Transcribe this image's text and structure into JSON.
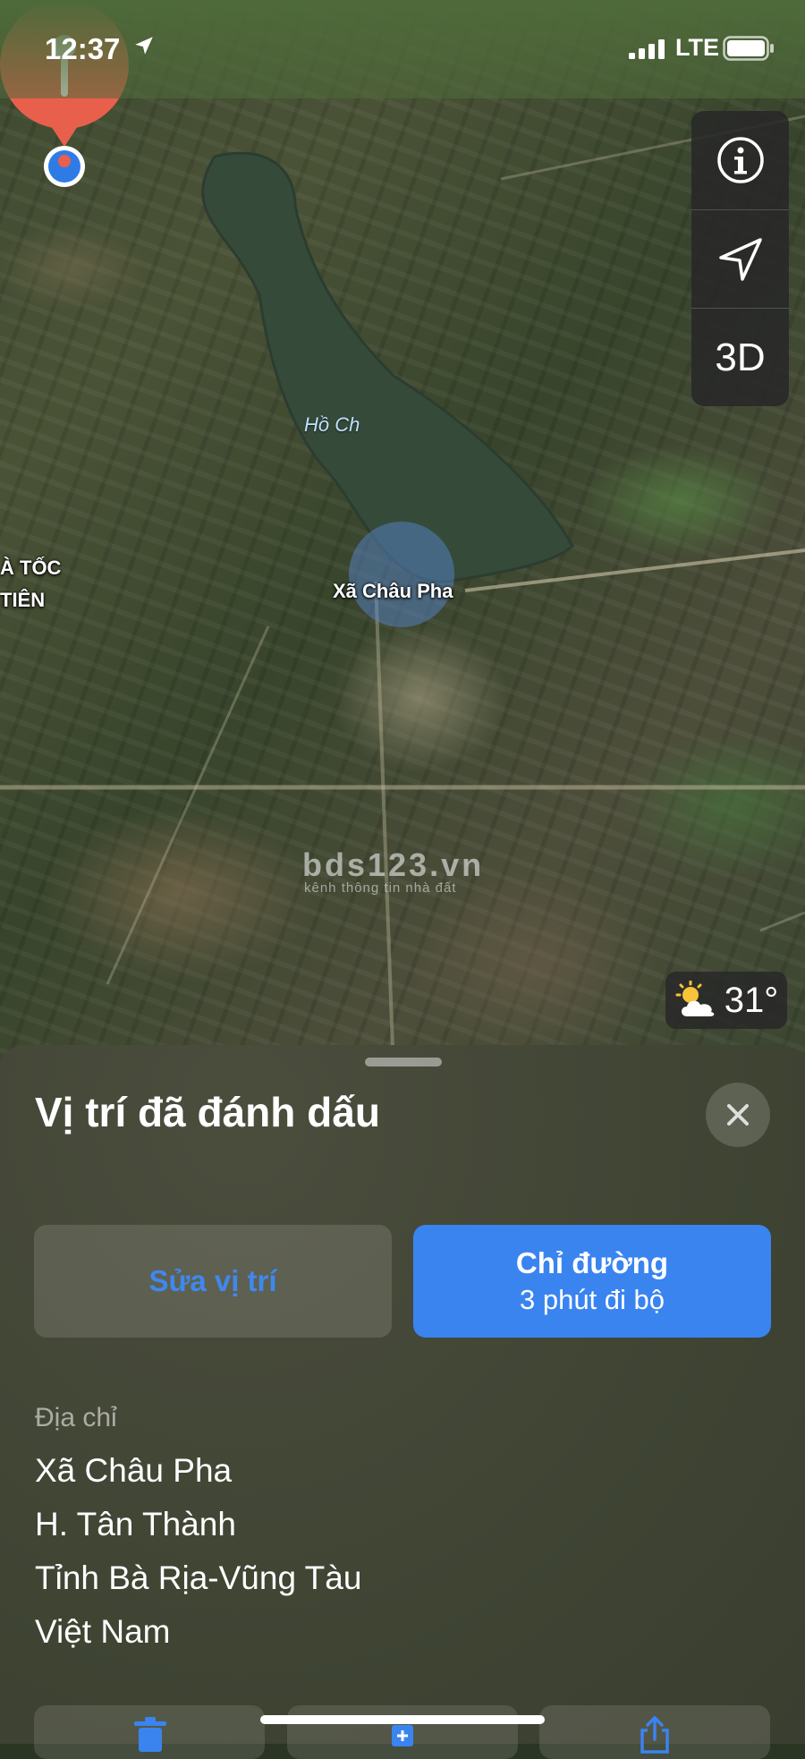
{
  "status_bar": {
    "time": "12:37",
    "network": "LTE"
  },
  "map": {
    "lake_label": "Hồ Ch",
    "place_label": "Xã Châu Pha",
    "edge_labels": [
      "À TỐC",
      "TIÊN"
    ],
    "watermark": "bds123.vn",
    "watermark_sub": "kênh thông tin nhà đất",
    "controls": {
      "info_icon": "info-icon",
      "location_icon": "location-arrow-icon",
      "view_3d": "3D"
    },
    "weather": {
      "icon": "partly-cloudy-icon",
      "temperature": "31°"
    },
    "pin_color": "#e8604c"
  },
  "sheet": {
    "title": "Vị trí đã đánh dấu",
    "edit_button": "Sửa vị trí",
    "directions_button": {
      "label": "Chỉ đường",
      "detail": "3 phút đi bộ"
    },
    "address_label": "Địa chỉ",
    "address_lines": [
      "Xã Châu Pha",
      "H. Tân Thành",
      "Tỉnh Bà Rịa-Vũng Tàu",
      "Việt Nam"
    ],
    "actions": [
      "trash-icon",
      "add-icon",
      "share-icon"
    ]
  },
  "colors": {
    "accent": "#3a84f0",
    "pin": "#e8604c"
  }
}
